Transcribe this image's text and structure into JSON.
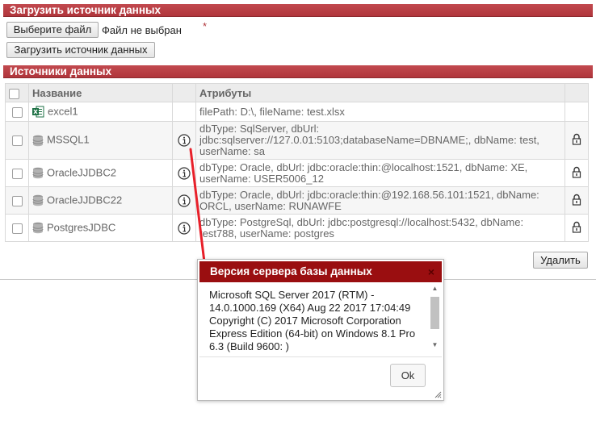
{
  "upload_section": {
    "title": "Загрузить источник данных",
    "choose_file_label": "Выберите файл",
    "no_file_text": "Файл не выбран",
    "required_mark": "*",
    "upload_button_label": "Загрузить источник данных"
  },
  "sources_section": {
    "title": "Источники данных",
    "columns": [
      "Название",
      "Атрибуты"
    ],
    "rows": [
      {
        "name": "excel1",
        "icon": "excel-file-icon",
        "attributes": "filePath: D:\\, fileName: test.xlsx",
        "info": false,
        "lock": false
      },
      {
        "name": "MSSQL1",
        "icon": "database-icon",
        "attributes": "dbType: SqlServer, dbUrl: jdbc:sqlserver://127.0.01:5103;databaseName=DBNAME;, dbName: test, userName: sa",
        "info": true,
        "lock": true
      },
      {
        "name": "OracleJJDBC2",
        "icon": "database-icon",
        "attributes": "dbType: Oracle, dbUrl: jdbc:oracle:thin:@localhost:1521, dbName: XE, userName: USER5006_12",
        "info": true,
        "lock": true
      },
      {
        "name": "OracleJJDBC22",
        "icon": "database-icon",
        "attributes": "dbType: Oracle, dbUrl: jdbc:oracle:thin:@192.168.56.101:1521, dbName: ORCL, userName: RUNAWFE",
        "info": true,
        "lock": true
      },
      {
        "name": "PostgresJDBC",
        "icon": "database-icon",
        "attributes": "dbType: PostgreSql, dbUrl: jdbc:postgresql://localhost:5432, dbName: test788, userName: postgres",
        "info": true,
        "lock": true
      }
    ],
    "delete_button_label": "Удалить"
  },
  "dialog": {
    "title": "Версия сервера базы данных",
    "close_glyph": "×",
    "text": "Microsoft SQL Server 2017 (RTM) - 14.0.1000.169 (X64) Aug 22 2017 17:04:49 Copyright (C) 2017 Microsoft Corporation Express Edition (64-bit) on Windows 8.1 Pro 6.3 (Build 9600: )",
    "ok_label": "Ok"
  },
  "colors": {
    "section_header": "#b0353b",
    "dialog_title": "#9a0e10",
    "annotation_arrow": "#e8202a"
  }
}
